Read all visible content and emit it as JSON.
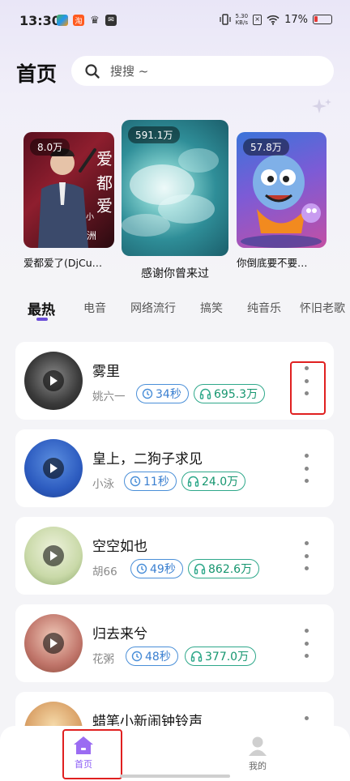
{
  "status_bar": {
    "time": "13:30",
    "net_speed_value": "5.30",
    "net_speed_unit": "KB/s",
    "battery": "17%",
    "battery_color": "#e53935"
  },
  "header": {
    "title": "首页",
    "search_placeholder": "搜搜 ~"
  },
  "banners": [
    {
      "plays": "8.0万",
      "caption": "爱都爱了(DjCu…"
    },
    {
      "plays": "591.1万",
      "caption": "感谢你曾来过"
    },
    {
      "plays": "57.8万",
      "caption": "你倒底要不要…"
    }
  ],
  "tabs": [
    "最热",
    "电音",
    "网络流行",
    "搞笑",
    "纯音乐",
    "怀旧老歌"
  ],
  "songs": [
    {
      "title": "雾里",
      "artist": "姚六一",
      "duration": "34秒",
      "listens": "695.3万"
    },
    {
      "title": "皇上，二狗子求见",
      "artist": "小泳",
      "duration": "11秒",
      "listens": "24.0万"
    },
    {
      "title": "空空如也",
      "artist": "胡66",
      "duration": "49秒",
      "listens": "862.6万"
    },
    {
      "title": "归去来兮",
      "artist": "花粥",
      "duration": "48秒",
      "listens": "377.0万"
    },
    {
      "title": "蜡笔小新闹钟铃声",
      "artist": "",
      "duration": "",
      "listens": ""
    }
  ],
  "bottom_nav": {
    "home": "首页",
    "mine": "我的"
  },
  "colors": {
    "accent": "#8b5cf6",
    "duration_pill": "#4a8fd8",
    "listens_pill": "#2ea88a",
    "highlight": "#e02020"
  }
}
